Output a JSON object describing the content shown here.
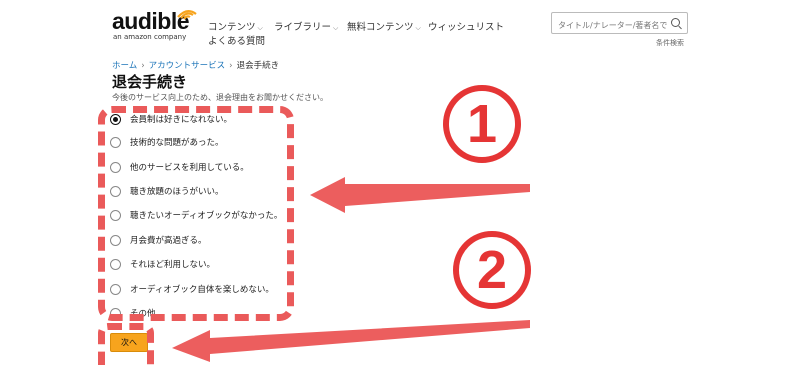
{
  "header": {
    "logo": {
      "word": "audible",
      "sub": "an amazon company"
    },
    "nav": [
      {
        "label": "コンテンツ",
        "chevron": true
      },
      {
        "label": "ライブラリー",
        "chevron": true
      },
      {
        "label": "無料コンテンツ",
        "chevron": true
      },
      {
        "label": "ウィッシュリスト",
        "chevron": false
      }
    ],
    "nav_faq": "よくある質問",
    "search": {
      "placeholder": "タイトル/ナレーター/著者名で",
      "advanced": "条件検索"
    }
  },
  "breadcrumb": {
    "home": "ホーム",
    "account": "アカウントサービス",
    "current": "退会手続き",
    "sep": "›"
  },
  "page": {
    "title": "退会手続き",
    "subtitle": "今後のサービス向上のため、退会理由をお聞かせください。"
  },
  "reasons": [
    {
      "label": "会員制は好きになれない。",
      "checked": true
    },
    {
      "label": "技術的な問題があった。",
      "checked": false
    },
    {
      "label": "他のサービスを利用している。",
      "checked": false
    },
    {
      "label": "聴き放題のほうがいい。",
      "checked": false
    },
    {
      "label": "聴きたいオーディオブックがなかった。",
      "checked": false
    },
    {
      "label": "月会費が高過ぎる。",
      "checked": false
    },
    {
      "label": "それほど利用しない。",
      "checked": false
    },
    {
      "label": "オーディオブック自体を楽しめない。",
      "checked": false
    },
    {
      "label": "その他",
      "checked": false
    }
  ],
  "next_button": "次へ",
  "annotations": {
    "one": "1",
    "two": "2"
  },
  "colors": {
    "annotation": "#e53535",
    "button": "#f7a41d",
    "link": "#1a73b8"
  }
}
